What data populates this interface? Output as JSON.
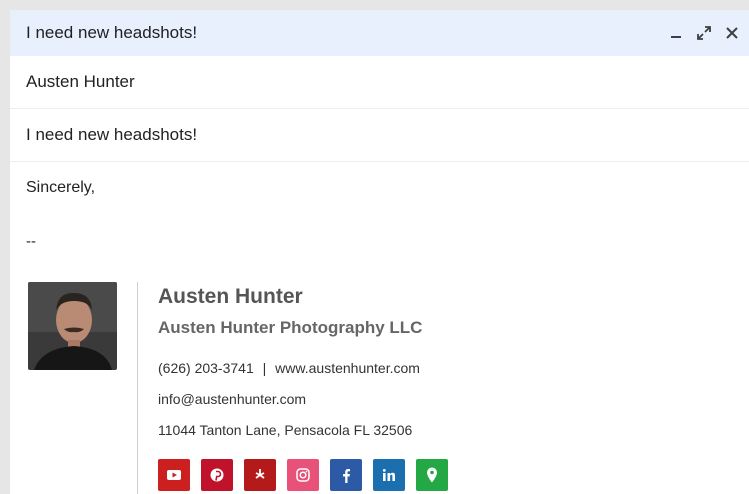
{
  "window": {
    "title": "I need new headshots!"
  },
  "fields": {
    "to": "Austen Hunter",
    "subject": "I need new headshots!"
  },
  "body": {
    "closing": "Sincerely,",
    "separator": "--"
  },
  "signature": {
    "name": "Austen Hunter",
    "company": "Austen Hunter Photography LLC",
    "phone": "(626) 203-3741",
    "sep": "|",
    "website": "www.austenhunter.com",
    "email": "info@austenhunter.com",
    "address": "11044 Tanton Lane, Pensacola FL 32506"
  },
  "social_icons": [
    {
      "name": "youtube-icon",
      "color": "#cc1f1f"
    },
    {
      "name": "pinterest-icon",
      "color": "#c0122a"
    },
    {
      "name": "yelp-icon",
      "color": "#b51a1a"
    },
    {
      "name": "instagram-icon",
      "color": "#e8527a"
    },
    {
      "name": "facebook-icon",
      "color": "#2d5aa6"
    },
    {
      "name": "linkedin-icon",
      "color": "#1b6fae"
    },
    {
      "name": "map-pin-icon",
      "color": "#23a845"
    }
  ]
}
